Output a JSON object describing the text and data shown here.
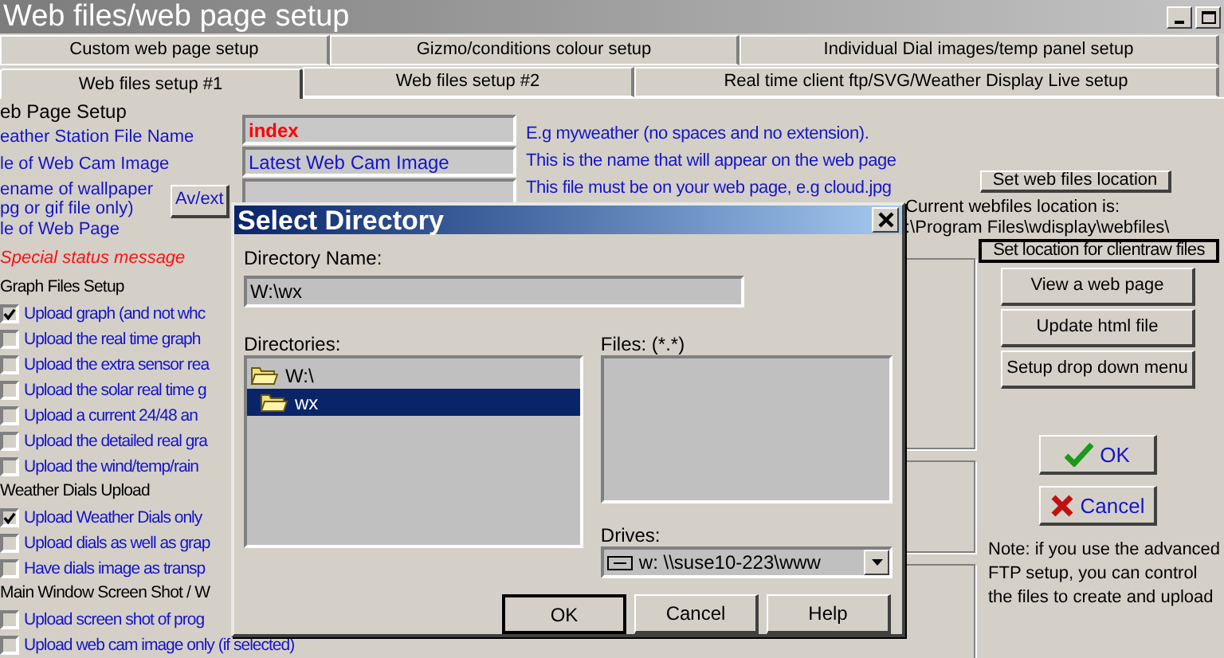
{
  "window": {
    "title": "Web files/web page setup"
  },
  "tab_rows": [
    [
      {
        "label": "Custom web page setup",
        "selected": false
      },
      {
        "label": "Gizmo/conditions colour setup",
        "selected": false
      },
      {
        "label": "Individual Dial images/temp panel setup",
        "selected": false
      }
    ],
    [
      {
        "label": "Web files setup #1",
        "selected": true
      },
      {
        "label": "Web files setup #2",
        "selected": false
      },
      {
        "label": "Real time client ftp/SVG/Weather Display Live setup",
        "selected": false
      }
    ]
  ],
  "web_page_setup": {
    "title": "eb Page Setup",
    "labels": [
      {
        "text": "eather Station File Name",
        "kind": "label"
      },
      {
        "text": "le of Web Cam Image",
        "kind": "label"
      },
      {
        "text": "ename of wallpaper",
        "kind": "label"
      },
      {
        "text": "pg or gif file only)",
        "kind": "label"
      },
      {
        "text": "le of Web Page",
        "kind": "label"
      },
      {
        "text": "Special status message",
        "kind": "status"
      }
    ],
    "av_button": "Av/ext",
    "fields": [
      {
        "value": "index",
        "kind": "emphasis"
      },
      {
        "value": "Latest Web Cam Image",
        "kind": "plain"
      },
      {
        "kind": "plain"
      }
    ],
    "hints": [
      "E.g  myweather  (no spaces and no extension).",
      "This is the name that will appear on the web page",
      "This file must be on your web page, e.g cloud.jpg"
    ]
  },
  "groups": [
    {
      "title": "Graph Files Setup",
      "options": [
        {
          "label": "Upload graph (and not whc",
          "checked": true
        },
        {
          "label": "Upload the real time graph",
          "checked": false
        },
        {
          "label": "Upload the extra sensor rea",
          "checked": false
        },
        {
          "label": "Upload the solar real time g",
          "checked": false
        },
        {
          "label": "Upload a current 24/48 an",
          "checked": false
        },
        {
          "label": "Upload the detailed real gra",
          "checked": false
        },
        {
          "label": "Upload the wind/temp/rain",
          "checked": false
        }
      ]
    },
    {
      "title": "Weather Dials Upload",
      "options": [
        {
          "label": "Upload Weather Dials only",
          "checked": true
        },
        {
          "label": "Upload dials as well as grap",
          "checked": false
        },
        {
          "label": "Have dials image as transp",
          "checked": false
        }
      ]
    },
    {
      "title": "Main Window Screen Shot / W",
      "options": [
        {
          "label": "Upload screen shot of prog",
          "checked": false
        },
        {
          "label": "Upload web cam image only (if selected)",
          "checked": false
        }
      ]
    }
  ],
  "right_panel": {
    "location_button": "Set web files location",
    "location_label": "Current webfiles location is:",
    "location_path": ":\\Program Files\\wdisplay\\webfiles\\",
    "clientraw_button": "Set location for clientraw files",
    "buttons": [
      "View a web page",
      "Update html file",
      "Setup drop down menu"
    ],
    "ok": "OK",
    "cancel": "Cancel",
    "note": "Note: if you use the advanced\nFTP setup, you can  control\nthe files to create and upload"
  },
  "dialog": {
    "title": "Select Directory",
    "directory_name_label": "Directory Name:",
    "directory_name": "W:\\wx",
    "directories_label": "Directories:",
    "directories": [
      {
        "name": "W:\\",
        "selected": false
      },
      {
        "name": "wx",
        "selected": true
      }
    ],
    "files_label": "Files: (*.*)",
    "drives_label": "Drives:",
    "drive": "w: \\\\suse10-223\\www",
    "buttons": [
      "OK",
      "Cancel",
      "Help"
    ]
  }
}
